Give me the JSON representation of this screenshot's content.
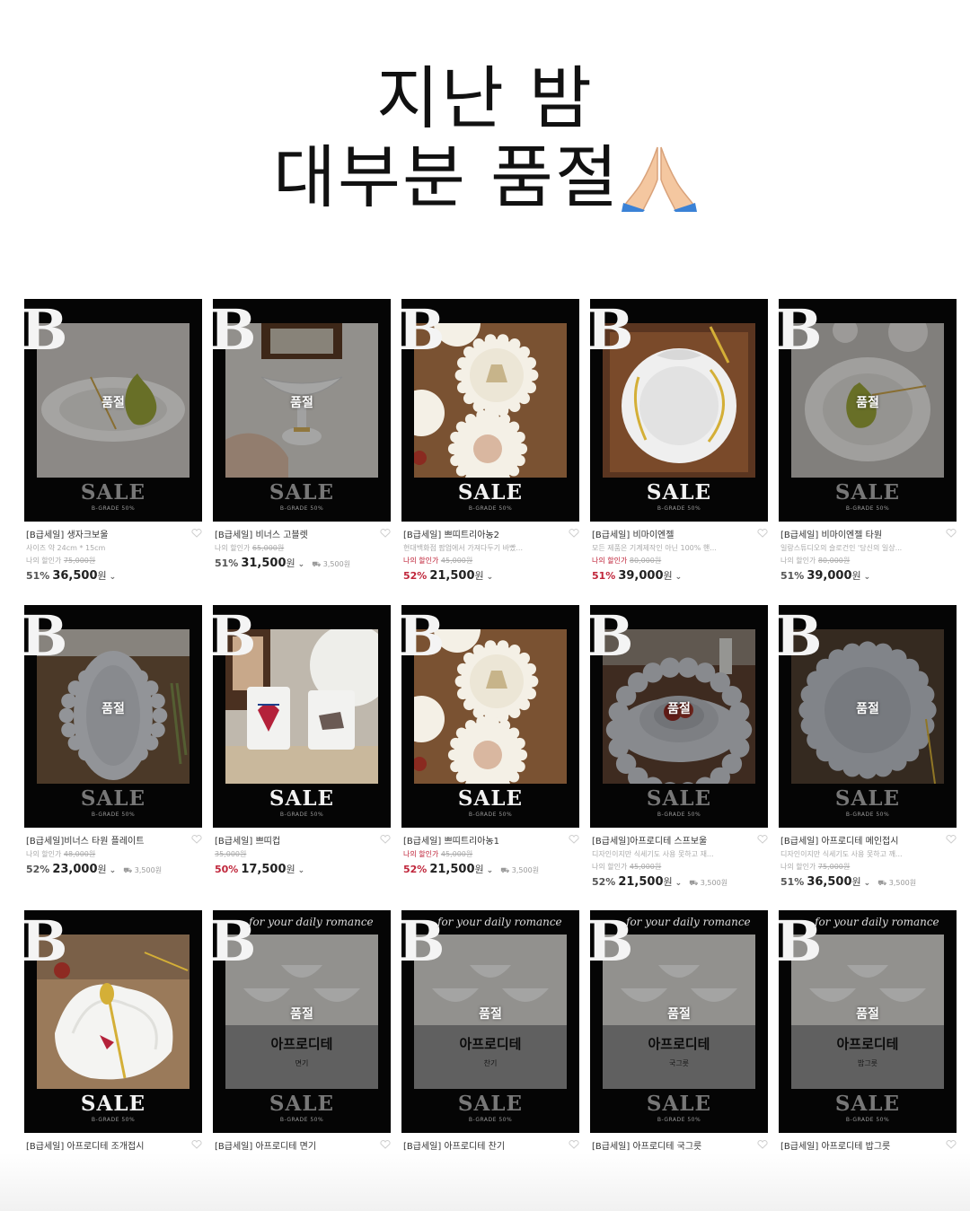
{
  "headline": {
    "line1": "지난 밤",
    "line2": "대부분 품절"
  },
  "badge": {
    "sale": "SALE",
    "grade": "B-GRADE 50%",
    "logo": "B",
    "soldout": "품절",
    "script": "for your daily romance"
  },
  "products": [
    {
      "name": "[B급세일] 생자크보울",
      "desc": "사이즈 약 24cm * 15cm",
      "orig_label": "나의 할인가",
      "orig": "75,000원",
      "pct": "51%",
      "price": "36,500",
      "unit": "원",
      "ship": "",
      "soldout": true,
      "red": false,
      "photo": "pear-plate"
    },
    {
      "name": "[B급세일] 비너스 고블렛",
      "desc": "",
      "orig_label": "나의 할인가",
      "orig": "65,000원",
      "pct": "51%",
      "price": "31,500",
      "unit": "원",
      "ship": "3,500원",
      "soldout": true,
      "red": false,
      "photo": "goblet"
    },
    {
      "name": "[B급세일] 쁘띠트리아농2",
      "desc": "현대백화점 팝업에서 가져다두기 바빴...",
      "orig_label": "나의 할인가",
      "orig": "45,000원",
      "pct": "52%",
      "price": "21,500",
      "unit": "원",
      "ship": "",
      "soldout": false,
      "red": true,
      "photo": "small-plates"
    },
    {
      "name": "[B급세일] 비마이엔젤",
      "desc": "모든 제품은 기계제작인 아닌 100% 핸...",
      "orig_label": "나의 할인가",
      "orig": "80,000원",
      "pct": "51%",
      "price": "39,000",
      "unit": "원",
      "ship": "",
      "soldout": false,
      "red": true,
      "photo": "angel-plate"
    },
    {
      "name": "[B급세일] 비마이엔젤 타원",
      "desc": "일랑스튜디오의 슬로건인 '당신의 일상...",
      "orig_label": "나의 할인가",
      "orig": "80,000원",
      "pct": "51%",
      "price": "39,000",
      "unit": "원",
      "ship": "",
      "soldout": true,
      "red": false,
      "photo": "pear-oval"
    },
    {
      "name": "[B급세일]비너스 타원 플레이트",
      "desc": "",
      "orig_label": "나의 할인가",
      "orig": "48,000원",
      "pct": "52%",
      "price": "23,000",
      "unit": "원",
      "ship": "3,500원",
      "soldout": true,
      "red": false,
      "photo": "oval-platter"
    },
    {
      "name": "[B급세일] 쁘띠컵",
      "desc": "",
      "orig_label": "",
      "orig": "35,000원",
      "pct": "50%",
      "price": "17,500",
      "unit": "원",
      "ship": "",
      "soldout": false,
      "red": true,
      "photo": "mugs"
    },
    {
      "name": "[B급세일] 쁘띠트리아농1",
      "desc": "",
      "orig_label": "나의 할인가",
      "orig": "45,000원",
      "pct": "52%",
      "price": "21,500",
      "unit": "원",
      "ship": "3,500원",
      "soldout": false,
      "red": true,
      "photo": "small-plates"
    },
    {
      "name": "[B급세일]아프로디테 스프보울",
      "desc": "디자인이지만 식세기도 사용 못하고 재...",
      "orig_label": "나의 할인가",
      "orig": "45,000원",
      "pct": "52%",
      "price": "21,500",
      "unit": "원",
      "ship": "3,500원",
      "soldout": true,
      "red": false,
      "photo": "soup-bowl"
    },
    {
      "name": "[B급세일] 아프로디테 메인접시",
      "desc": "디자인이지만 식세기도 사용 못하고 깨...",
      "orig_label": "나의 할인가",
      "orig": "75,000원",
      "pct": "51%",
      "price": "36,500",
      "unit": "원",
      "ship": "3,500원",
      "soldout": true,
      "red": false,
      "photo": "main-plate"
    },
    {
      "name": "[B급세일] 아프로디테 조개접시",
      "desc": "",
      "orig_label": "",
      "orig": "",
      "pct": "",
      "price": "",
      "unit": "",
      "ship": "",
      "soldout": false,
      "red": false,
      "photo": "shell-plate"
    },
    {
      "name": "[B급세일] 아프로디테 면기",
      "desc": "",
      "orig_label": "",
      "orig": "",
      "pct": "",
      "price": "",
      "unit": "",
      "ship": "",
      "soldout": true,
      "red": false,
      "photo": "bowls",
      "banner_title": "아프로디테",
      "banner_sub": "면기"
    },
    {
      "name": "[B급세일] 아프로디테 찬기",
      "desc": "",
      "orig_label": "",
      "orig": "",
      "pct": "",
      "price": "",
      "unit": "",
      "ship": "",
      "soldout": true,
      "red": false,
      "photo": "bowls",
      "banner_title": "아프로디테",
      "banner_sub": "찬기"
    },
    {
      "name": "[B급세일] 아프로디테 국그릇",
      "desc": "",
      "orig_label": "",
      "orig": "",
      "pct": "",
      "price": "",
      "unit": "",
      "ship": "",
      "soldout": true,
      "red": false,
      "photo": "bowls",
      "banner_title": "아프로디테",
      "banner_sub": "국그릇"
    },
    {
      "name": "[B급세일] 아프로디테 밥그릇",
      "desc": "",
      "orig_label": "",
      "orig": "",
      "pct": "",
      "price": "",
      "unit": "",
      "ship": "",
      "soldout": true,
      "red": false,
      "photo": "bowls",
      "banner_title": "아프로디테",
      "banner_sub": "밥그릇"
    }
  ],
  "colors": {
    "discount_red": "#c0263b",
    "card_bg": "#050505",
    "banner_gray": "#8e8e8e"
  }
}
